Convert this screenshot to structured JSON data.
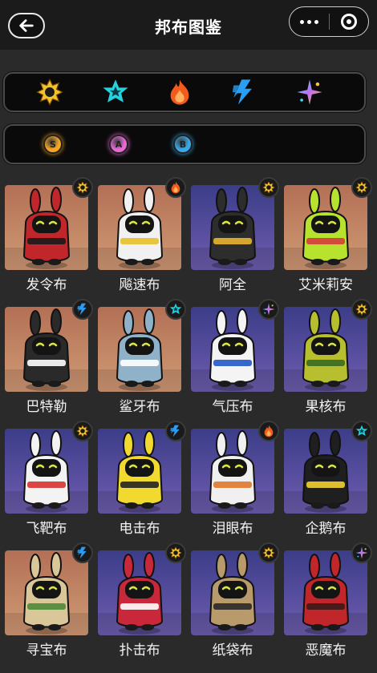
{
  "header": {
    "title": "邦布图鉴"
  },
  "element_filters": [
    {
      "icon": "sun-icon",
      "color": "#f2c12e"
    },
    {
      "icon": "star-icon",
      "color": "#23d3e0"
    },
    {
      "icon": "fire-icon",
      "color": "#f25a1e"
    },
    {
      "icon": "lightning-icon",
      "color": "#2a9ef5"
    },
    {
      "icon": "sparkle-icon",
      "color": "#c46bf0"
    }
  ],
  "grade_filters": [
    {
      "label": "S",
      "color": "#f5a623"
    },
    {
      "label": "A",
      "color": "#e86ad6"
    },
    {
      "label": "B",
      "color": "#3aa8e8"
    }
  ],
  "cards": [
    {
      "name": "发令布",
      "element": "sun",
      "bg": "warm",
      "body": "#c0262a",
      "accent": "#1a1a1a"
    },
    {
      "name": "飚速布",
      "element": "fire",
      "bg": "warm",
      "body": "#f1f1f1",
      "accent": "#e6c02a"
    },
    {
      "name": "阿全",
      "element": "sun",
      "bg": "cool",
      "body": "#2d2d2d",
      "accent": "#e9b530"
    },
    {
      "name": "艾米莉安",
      "element": "sun",
      "bg": "warm",
      "body": "#b7e22d",
      "accent": "#d63b3b"
    },
    {
      "name": "巴特勒",
      "element": "lightning",
      "bg": "warm",
      "body": "#2a2a2a",
      "accent": "#ffffff"
    },
    {
      "name": "鲨牙布",
      "element": "star",
      "bg": "warm",
      "body": "#8fb2c8",
      "accent": "#ffffff"
    },
    {
      "name": "气压布",
      "element": "sparkle",
      "bg": "cool",
      "body": "#f4f4f4",
      "accent": "#2256c9"
    },
    {
      "name": "果核布",
      "element": "sun",
      "bg": "cool",
      "body": "#b8bf2e",
      "accent": "#3a6a20"
    },
    {
      "name": "飞靶布",
      "element": "sun",
      "bg": "cool",
      "body": "#f3f3f3",
      "accent": "#d8322f"
    },
    {
      "name": "电击布",
      "element": "lightning",
      "bg": "cool",
      "body": "#f2d92f",
      "accent": "#222222"
    },
    {
      "name": "泪眼布",
      "element": "fire",
      "bg": "cool",
      "body": "#f0f0f0",
      "accent": "#e0782b"
    },
    {
      "name": "企鹅布",
      "element": "star",
      "bg": "cool",
      "body": "#1f1f1f",
      "accent": "#f2d12f"
    },
    {
      "name": "寻宝布",
      "element": "lightning",
      "bg": "warm",
      "body": "#d9c79a",
      "accent": "#4d8a3a"
    },
    {
      "name": "扑击布",
      "element": "sun",
      "bg": "cool",
      "body": "#c8283a",
      "accent": "#ffffff"
    },
    {
      "name": "纸袋布",
      "element": "sun",
      "bg": "cool",
      "body": "#b99a6b",
      "accent": "#2a2a2a"
    },
    {
      "name": "恶魔布",
      "element": "sparkle",
      "bg": "cool",
      "body": "#c0262a",
      "accent": "#3a1a1a"
    }
  ]
}
